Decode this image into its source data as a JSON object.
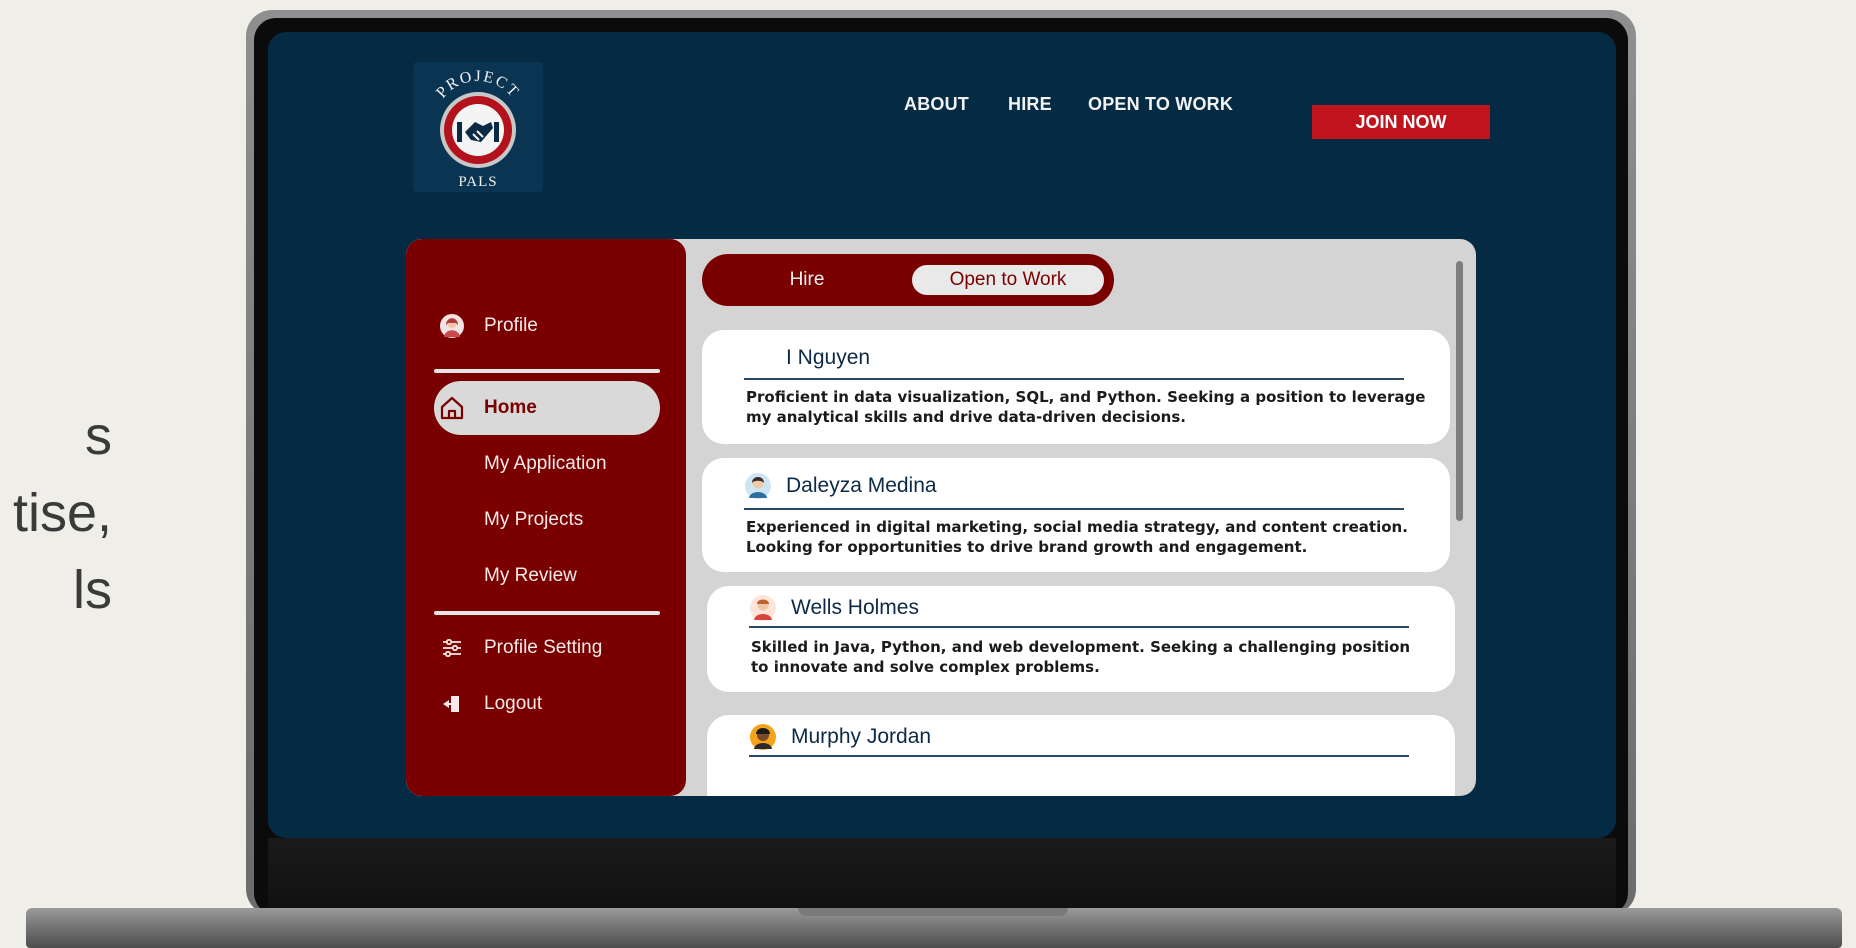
{
  "slide_text": "s\ntise,\nls",
  "logo": {
    "top_text": "PROJECT",
    "bottom_text": "PALS",
    "icon": "handshake-icon"
  },
  "nav": {
    "about": "ABOUT",
    "hire": "HIRE",
    "open_to_work": "OPEN TO WORK",
    "join_now": "JOIN NOW"
  },
  "sidebar": {
    "items": [
      {
        "label": "Profile",
        "icon": "profile-avatar-icon"
      },
      {
        "label": "Home",
        "icon": "home-icon"
      },
      {
        "label": "My Application"
      },
      {
        "label": "My Projects"
      },
      {
        "label": "My Review"
      },
      {
        "label": "Profile Setting",
        "icon": "sliders-icon"
      },
      {
        "label": "Logout",
        "icon": "logout-icon"
      }
    ]
  },
  "tabs": {
    "hire": "Hire",
    "open_to_work": "Open to Work"
  },
  "cards": [
    {
      "name": "I Nguyen",
      "desc": "Proficient in data visualization, SQL, and Python. Seeking a position to leverage my analytical skills and drive data-driven decisions."
    },
    {
      "name": "Daleyza Medina",
      "desc": "Experienced in digital marketing, social media strategy, and content creation. Looking for opportunities to drive brand growth and engagement."
    },
    {
      "name": "Wells Holmes",
      "desc": "Skilled in Java, Python, and web development. Seeking a challenging position to innovate and solve complex problems."
    },
    {
      "name": "Murphy Jordan",
      "desc": ""
    }
  ],
  "colors": {
    "screen_bg": "#052a44",
    "sidebar_bg": "#7a0000",
    "accent_red": "#c0141c",
    "panel_bg": "#d4d4d4"
  }
}
